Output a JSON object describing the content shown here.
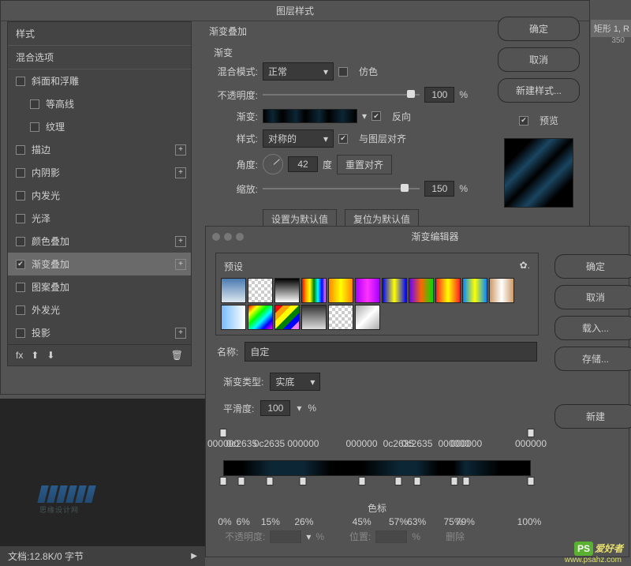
{
  "dialog1": {
    "title": "图层样式",
    "styles_header": "样式",
    "blend_header": "混合选项",
    "items": [
      {
        "label": "斜面和浮雕",
        "checked": false,
        "plus": false,
        "indent": false
      },
      {
        "label": "等高线",
        "checked": false,
        "plus": false,
        "indent": true
      },
      {
        "label": "纹理",
        "checked": false,
        "plus": false,
        "indent": true
      },
      {
        "label": "描边",
        "checked": false,
        "plus": true,
        "indent": false
      },
      {
        "label": "内阴影",
        "checked": false,
        "plus": true,
        "indent": false
      },
      {
        "label": "内发光",
        "checked": false,
        "plus": false,
        "indent": false
      },
      {
        "label": "光泽",
        "checked": false,
        "plus": false,
        "indent": false
      },
      {
        "label": "颜色叠加",
        "checked": false,
        "plus": true,
        "indent": false
      },
      {
        "label": "渐变叠加",
        "checked": true,
        "plus": true,
        "indent": false,
        "active": true
      },
      {
        "label": "图案叠加",
        "checked": false,
        "plus": false,
        "indent": false
      },
      {
        "label": "外发光",
        "checked": false,
        "plus": false,
        "indent": false
      },
      {
        "label": "投影",
        "checked": false,
        "plus": true,
        "indent": false
      }
    ],
    "fx_label": "fx"
  },
  "center": {
    "section_title": "渐变叠加",
    "group_title": "渐变",
    "blend_mode_label": "混合模式:",
    "blend_mode_value": "正常",
    "dither_label": "仿色",
    "opacity_label": "不透明度:",
    "opacity_value": "100",
    "gradient_label": "渐变:",
    "reverse_label": "反向",
    "style_label": "样式:",
    "style_value": "对称的",
    "align_label": "与图层对齐",
    "angle_label": "角度:",
    "angle_value": "42",
    "degree_label": "度",
    "reset_align": "重置对齐",
    "scale_label": "缩放:",
    "scale_value": "150",
    "percent": "%",
    "set_default": "设置为默认值",
    "reset_default": "复位为默认值"
  },
  "right": {
    "ok": "确定",
    "cancel": "取消",
    "new_style": "新建样式...",
    "preview": "预览"
  },
  "layer_tab": "矩形 1, R",
  "ruler_num": "350",
  "dialog2": {
    "title": "渐变编辑器",
    "preset_label": "预设",
    "ok": "确定",
    "cancel": "取消",
    "load": "载入...",
    "save": "存储...",
    "new": "新建",
    "name_label": "名称:",
    "name_value": "自定",
    "type_label": "渐变类型:",
    "type_value": "实底",
    "smooth_label": "平滑度:",
    "smooth_value": "100",
    "percent": "%",
    "stops_title": "色标",
    "opacity_label": "不透明度:",
    "position_label": "位置:",
    "delete_label": "删除",
    "color_labels": [
      "000000",
      "0c2635",
      "0c2635",
      "000000",
      "000000",
      "0c2635",
      "0c2635",
      "000000",
      "000000",
      "000000"
    ],
    "percents": [
      "0%",
      "6%",
      "15%",
      "26%",
      "45%",
      "57%",
      "63%",
      "75%",
      "79%",
      "100%"
    ],
    "presets": [
      "linear-gradient(#4a7ab0,#dce8f0)",
      "repeating-conic-gradient(#ccc 0 25%,#fff 0 50%) 0/8px 8px",
      "linear-gradient(#000,#fff)",
      "linear-gradient(90deg,red,orange,yellow,green,cyan,blue,violet)",
      "linear-gradient(90deg,#f80,#ff0,#f80)",
      "linear-gradient(90deg,#a0f,#f3f,#a0f)",
      "linear-gradient(90deg,#00f,#ff0,#00f)",
      "linear-gradient(90deg,#60f,#f60,#0d0)",
      "linear-gradient(90deg,#f22,#ff0,#f22)",
      "linear-gradient(90deg,#08f,#ff0,#08f)",
      "linear-gradient(90deg,#c96,#fff,#c96)",
      "linear-gradient(90deg,#7bf,#fff)",
      "linear-gradient(135deg,red,yellow,lime,cyan,blue,magenta)",
      "linear-gradient(135deg,red 0 16%,orange 0 33%,yellow 0 50%,green 0 66%,blue 0 83%,violet 0)",
      "linear-gradient(#333,#ddd)",
      "repeating-conic-gradient(#ccc 0 25%,#fff 0 50%) 0/8px 8px",
      "linear-gradient(135deg,#aaa,#fff 50%,#aaa)"
    ]
  },
  "footer": {
    "doc_info": "文档:12.8K/0 字节"
  },
  "watermark": {
    "ps": "PS",
    "cn": "爱好者",
    "url": "www.psahz.com"
  }
}
